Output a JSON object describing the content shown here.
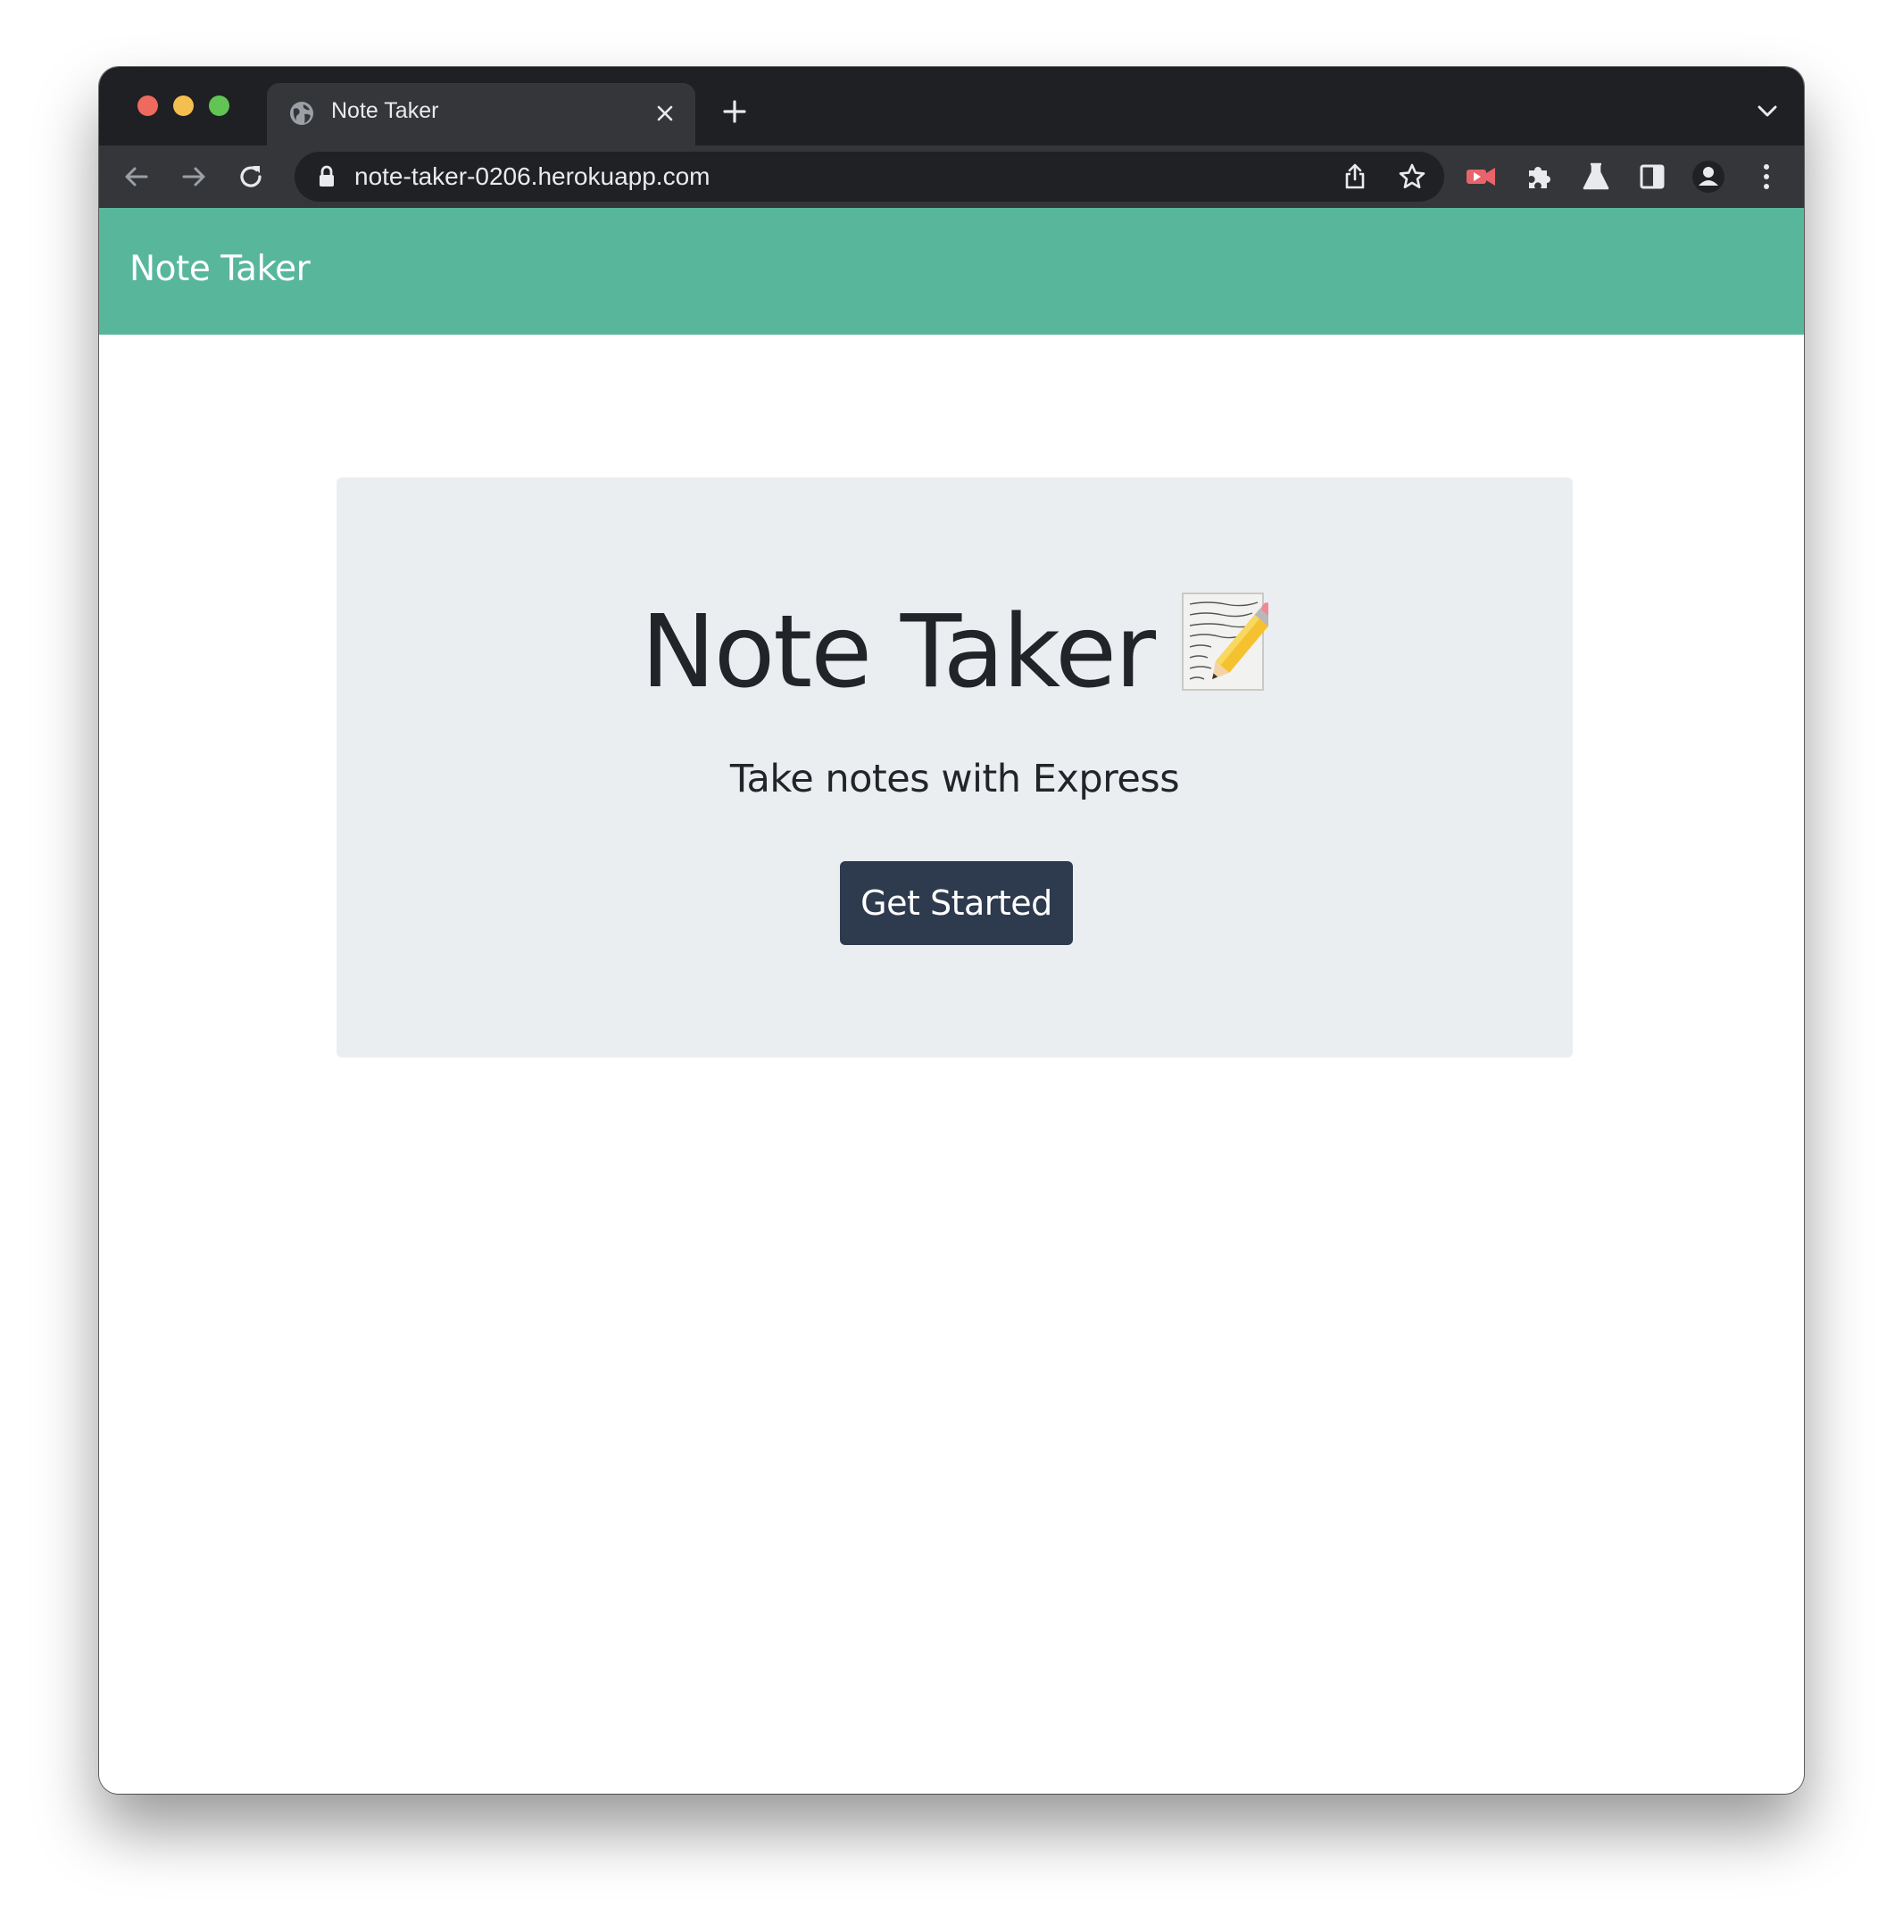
{
  "browser": {
    "tab_title": "Note Taker",
    "url": "note-taker-0206.herokuapp.com"
  },
  "navbar": {
    "brand": "Note Taker"
  },
  "hero": {
    "title": "Note Taker",
    "emoji": "📝",
    "subtitle": "Take notes with Express",
    "cta_label": "Get Started"
  },
  "colors": {
    "navbar_bg": "#58b79b",
    "jumbotron_bg": "#ebeef0",
    "button_bg": "#2e3b4e",
    "browser_frame": "#1f2023",
    "browser_toolbar": "#35363a"
  }
}
